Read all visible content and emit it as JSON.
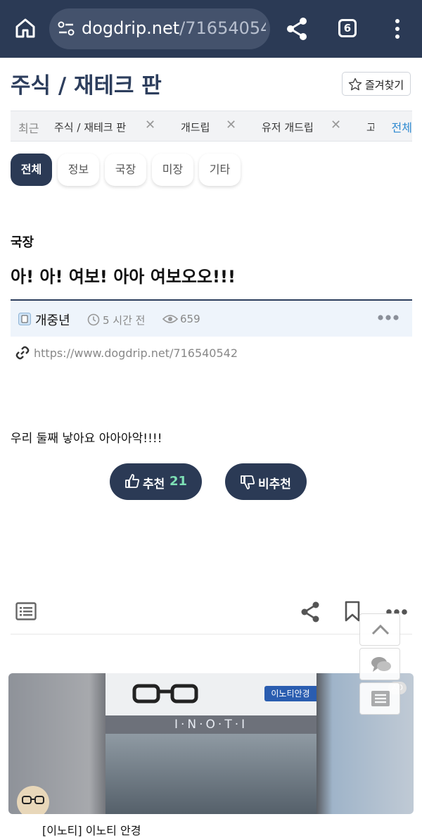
{
  "browser": {
    "url_host": "dogdrip.net",
    "url_path": "/71654054",
    "tab_count": "6"
  },
  "board": {
    "title": "주식 / 재테크 판",
    "favorite_label": "즐겨찾기"
  },
  "recent": {
    "label": "최근",
    "items": [
      "주식 / 재테크 판",
      "개드립",
      "유저 개드립",
      "고"
    ],
    "all_label": "전체"
  },
  "categories": [
    {
      "label": "전체",
      "active": true
    },
    {
      "label": "정보",
      "active": false
    },
    {
      "label": "국장",
      "active": false
    },
    {
      "label": "미장",
      "active": false
    },
    {
      "label": "기타",
      "active": false
    }
  ],
  "post": {
    "category": "국장",
    "title": "아! 아! 여보! 아아 여보오오!!!",
    "author": "개중년",
    "time": "5 시간 전",
    "views": "659",
    "link": "https://www.dogdrip.net/716540542",
    "body": "우리 둘째 낳아요 아아아악!!!!",
    "upvote_label": "추천",
    "upvote_count": "21",
    "downvote_label": "비추천"
  },
  "ad": {
    "badge": "AD",
    "brand": "I·N·O·T·I",
    "sign_text": "이노티안경",
    "caption": "[이노티] 이노티 안경"
  },
  "colors": {
    "nav_bg": "#2b3a55",
    "accent": "#2f8ad1",
    "upvote_count": "#7ee0b5"
  },
  "icons": [
    "home-icon",
    "tune-icon",
    "share-icon",
    "tabs-icon",
    "menu-icon",
    "star-icon",
    "close-icon",
    "clock-icon",
    "eye-icon",
    "link-icon",
    "thumbs-up-icon",
    "thumbs-down-icon",
    "list-icon",
    "bookmark-icon",
    "more-icon",
    "chevron-up-icon",
    "comments-icon"
  ]
}
